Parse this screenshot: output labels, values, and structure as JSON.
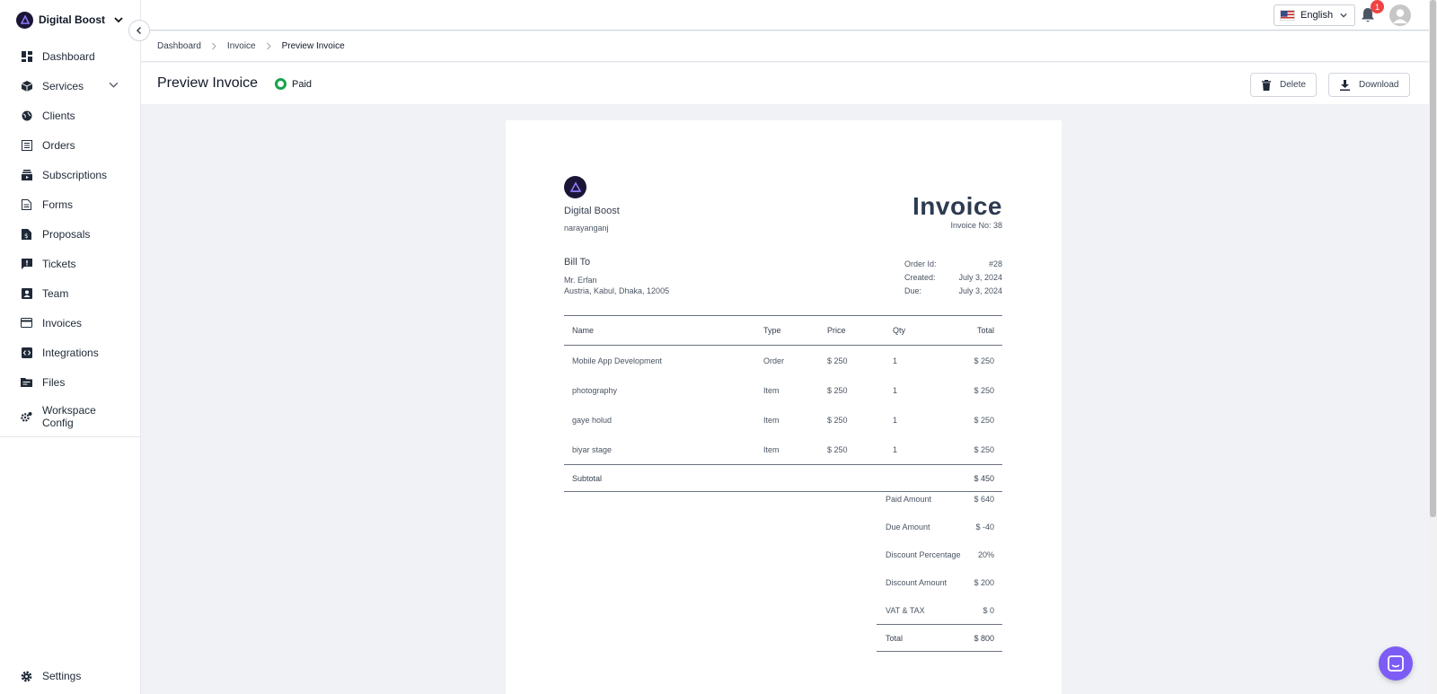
{
  "workspace": {
    "name": "Digital Boost"
  },
  "sidebar": {
    "items": [
      {
        "label": "Dashboard",
        "icon": "dashboard-icon"
      },
      {
        "label": "Services",
        "icon": "box-icon"
      },
      {
        "label": "Clients",
        "icon": "globe-icon"
      },
      {
        "label": "Orders",
        "icon": "list-icon"
      },
      {
        "label": "Subscriptions",
        "icon": "subscriptions-icon"
      },
      {
        "label": "Forms",
        "icon": "document-icon"
      },
      {
        "label": "Proposals",
        "icon": "dollar-document-icon"
      },
      {
        "label": "Tickets",
        "icon": "ticket-icon"
      },
      {
        "label": "Team",
        "icon": "contact-icon"
      },
      {
        "label": "Invoices",
        "icon": "credit-card-icon"
      },
      {
        "label": "Integrations",
        "icon": "code-icon"
      },
      {
        "label": "Files",
        "icon": "folder-icon"
      },
      {
        "label": "Workspace Config",
        "icon": "cogs-icon"
      }
    ],
    "settings_label": "Settings"
  },
  "topbar": {
    "language": "English",
    "notification_count": "1"
  },
  "breadcrumb": {
    "items": [
      "Dashboard",
      "Invoice",
      "Preview Invoice"
    ]
  },
  "page": {
    "title": "Preview Invoice",
    "status": "Paid",
    "delete_label": "Delete",
    "download_label": "Download"
  },
  "invoice": {
    "company": "Digital Boost",
    "address": "narayanganj",
    "title": "Invoice",
    "invoice_no": "Invoice No: 38",
    "bill_to_label": "Bill To",
    "client_name": "Mr. Erfan",
    "client_address": "Austria, Kabul, Dhaka, 12005",
    "meta": [
      {
        "label": "Order Id:",
        "value": "#28"
      },
      {
        "label": "Created:",
        "value": "July 3, 2024"
      },
      {
        "label": "Due:",
        "value": "July 3, 2024"
      }
    ],
    "columns": [
      "Name",
      "Type",
      "Price",
      "Qty",
      "Total"
    ],
    "rows": [
      {
        "name": "Mobile App Development",
        "type": "Order",
        "price": "$ 250",
        "qty": "1",
        "total": "$ 250"
      },
      {
        "name": "photography",
        "type": "Item",
        "price": "$ 250",
        "qty": "1",
        "total": "$ 250"
      },
      {
        "name": "gaye holud",
        "type": "Item",
        "price": "$ 250",
        "qty": "1",
        "total": "$ 250"
      },
      {
        "name": "biyar stage",
        "type": "Item",
        "price": "$ 250",
        "qty": "1",
        "total": "$ 250"
      }
    ],
    "subtotal_label": "Subtotal",
    "subtotal_value": "$ 450",
    "summary": [
      {
        "label": "Paid Amount",
        "value": "$ 640"
      },
      {
        "label": "Due Amount",
        "value": "$ -40"
      },
      {
        "label": "Discount Percentage",
        "value": "20%"
      },
      {
        "label": "Discount Amount",
        "value": "$ 200"
      },
      {
        "label": "VAT & TAX",
        "value": "$ 0"
      }
    ],
    "total_label": "Total",
    "total_value": "$ 800"
  },
  "colors": {
    "accent": "#7c5cf5",
    "paid": "#16a34a",
    "badge": "#ef4444",
    "brand_dark": "#1c1538"
  }
}
